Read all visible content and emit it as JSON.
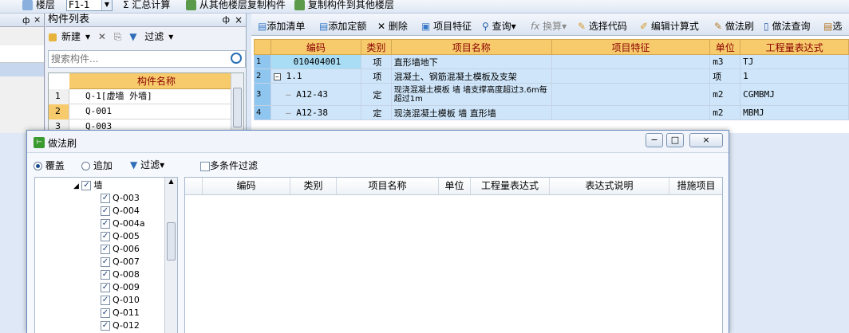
{
  "topbar": {
    "floor_label": "楼层",
    "floor_value": "F1-1",
    "summary": "汇总计算",
    "copy_from": "从其他楼层复制构件",
    "copy_to": "复制构件到其他楼层"
  },
  "components_pane": {
    "title": "构件列表",
    "pin": "ф",
    "close": "×",
    "new_label": "新建",
    "filter_label": "过滤",
    "search_placeholder": "搜索构件...",
    "column_header": "构件名称",
    "rows": [
      {
        "num": "1",
        "name": "Q-1[虚墙 外墙]"
      },
      {
        "num": "2",
        "name": "Q-001"
      },
      {
        "num": "3",
        "name": "Q-003"
      }
    ]
  },
  "left_pane": {
    "pin": "ф",
    "close": "×"
  },
  "right_toolbar": {
    "add_list": "添加清单",
    "add_quota": "添加定额",
    "delete": "删除",
    "item_feature": "项目特征",
    "query": "查询",
    "convert": "换算",
    "select_code": "选择代码",
    "edit_formula": "编辑计算式",
    "method_brush": "做法刷",
    "method_query": "做法查询",
    "more": "选"
  },
  "main_table": {
    "headers": [
      "编码",
      "类别",
      "项目名称",
      "项目特征",
      "单位",
      "工程量表达式"
    ],
    "rows": [
      {
        "num": "1",
        "code": "010404001",
        "type": "项",
        "name": "直形墙地下",
        "feature": "",
        "unit": "m3",
        "expr": "TJ"
      },
      {
        "num": "2",
        "code": "1.1",
        "type": "项",
        "name": "混凝土、钢筋混凝土模板及支架",
        "feature": "",
        "unit": "项",
        "expr": "1"
      },
      {
        "num": "3",
        "code": "A12-43",
        "type": "定",
        "name": "现浇混凝土模板 墙 墙支撑高度超过3.6m每超过1m",
        "feature": "",
        "unit": "m2",
        "expr": "CGMBMJ"
      },
      {
        "num": "4",
        "code": "A12-38",
        "type": "定",
        "name": "现浇混凝土模板 墙 直形墙",
        "feature": "",
        "unit": "m2",
        "expr": "MBMJ"
      }
    ]
  },
  "dialog": {
    "title": "做法刷",
    "subtitle": "",
    "minimize": "−",
    "maximize": "□",
    "close": "×",
    "overwrite": "覆盖",
    "append": "追加",
    "filter": "过滤",
    "multi_filter": "多条件过滤",
    "tree": {
      "root": "墙",
      "items": [
        "Q-003",
        "Q-004",
        "Q-004a",
        "Q-005",
        "Q-006",
        "Q-007",
        "Q-008",
        "Q-009",
        "Q-010",
        "Q-011",
        "Q-012"
      ]
    },
    "columns": [
      "编码",
      "类别",
      "项目名称",
      "单位",
      "工程量表达式",
      "表达式说明",
      "措施项目"
    ]
  },
  "colors": {
    "header_gold": "#f7cb6c",
    "row_blue": "#cfe6fa",
    "accent_green": "#3a9a2e"
  }
}
